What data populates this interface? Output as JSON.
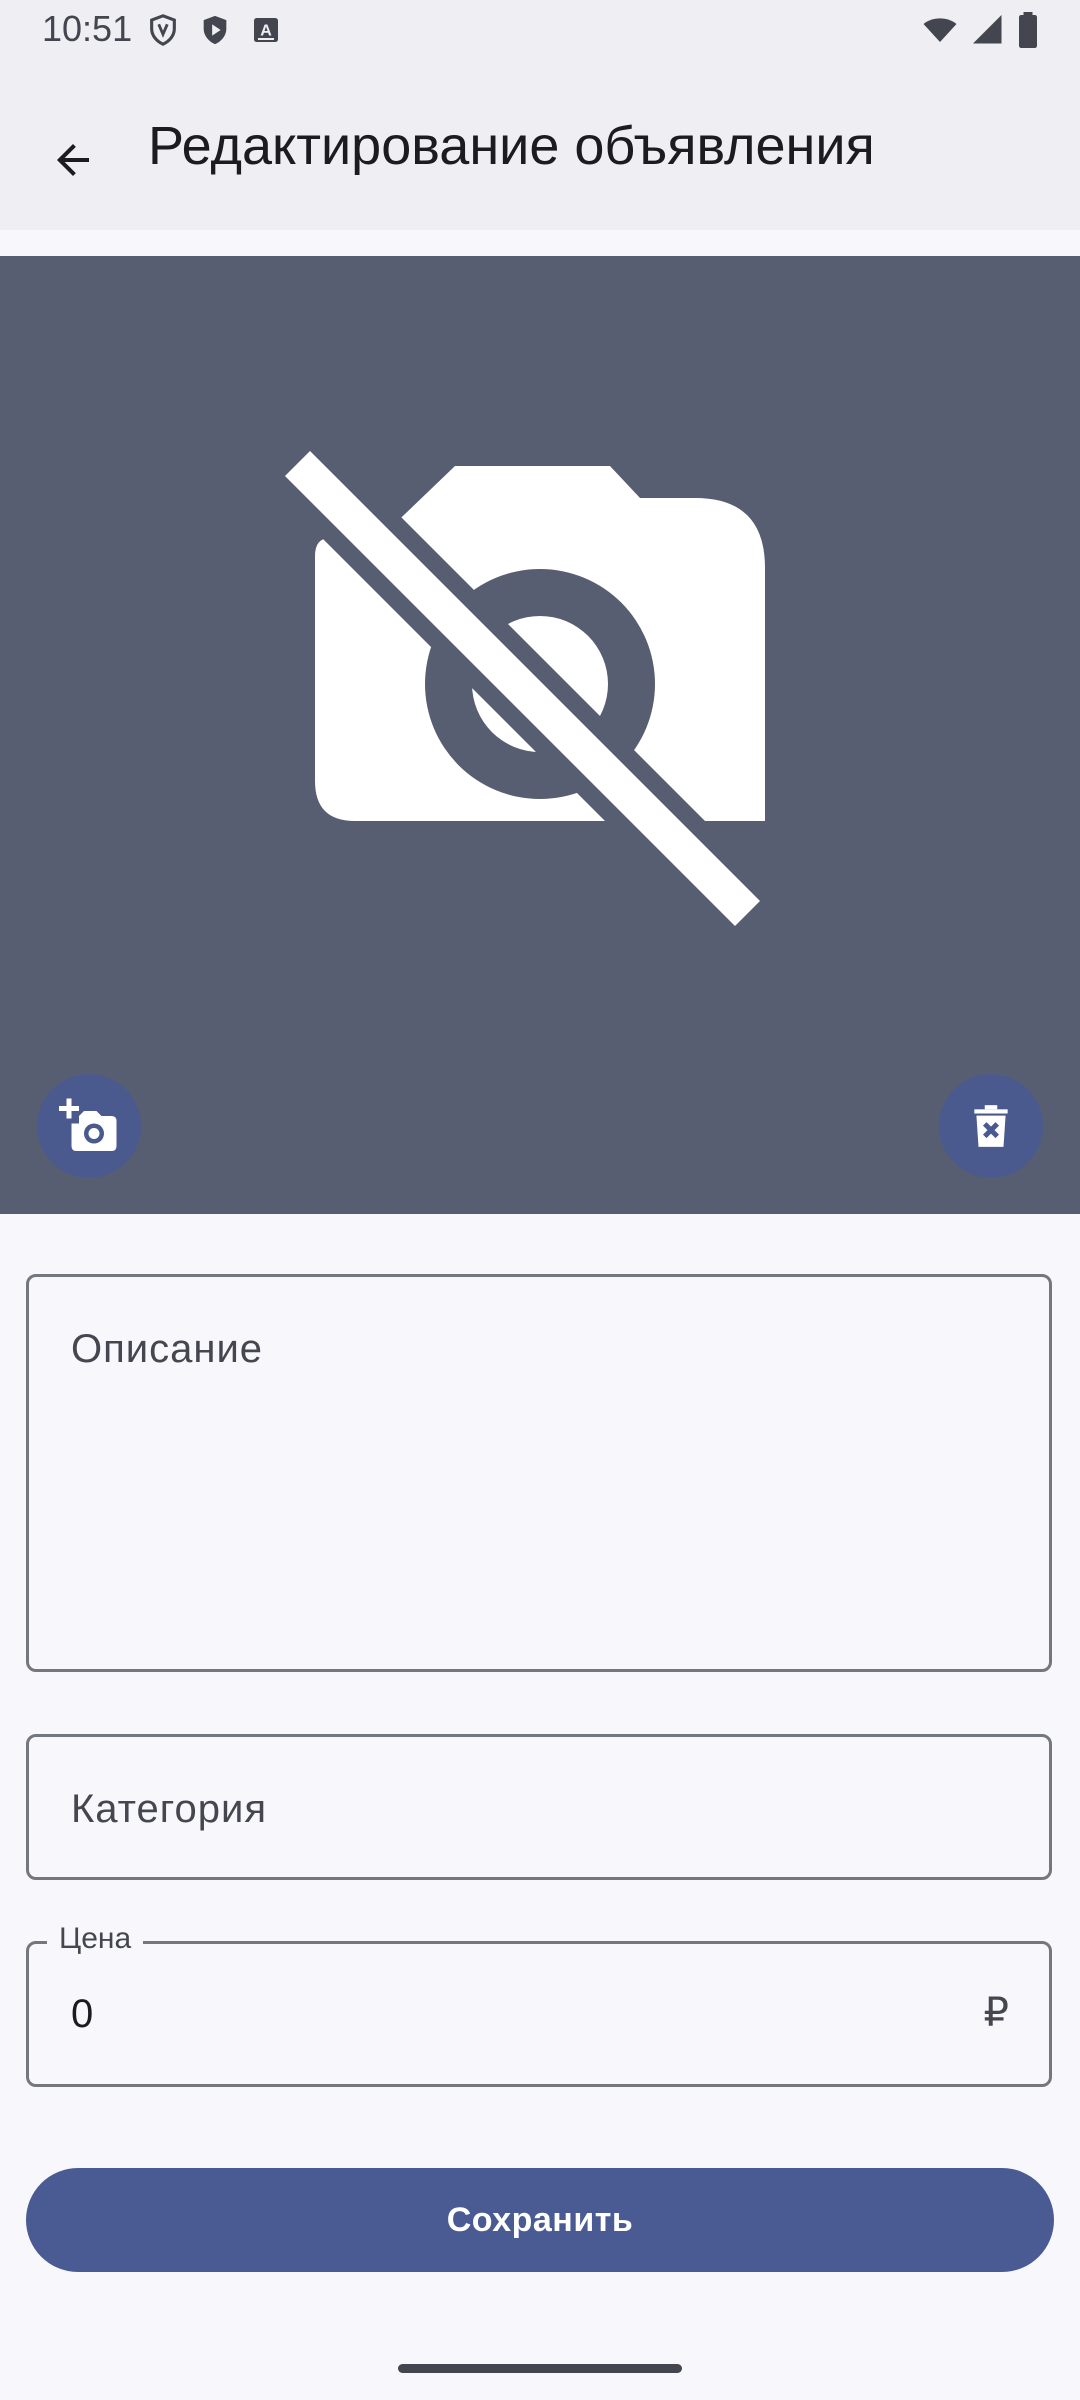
{
  "status_bar": {
    "time": "10:51",
    "left_icons": [
      "vpn-shield-icon",
      "play-protect-icon",
      "keyboard-a-icon"
    ],
    "right_icons": [
      "wifi-icon",
      "signal-icon",
      "battery-icon"
    ]
  },
  "app_bar": {
    "back_icon": "arrow-back-icon",
    "title": "Редактирование объявления"
  },
  "photo": {
    "placeholder_icon": "no-photography-icon",
    "add_icon": "add-a-photo-icon",
    "delete_icon": "delete-forever-icon"
  },
  "form": {
    "description": {
      "label": "Описание",
      "value": ""
    },
    "category": {
      "label": "Категория",
      "value": ""
    },
    "price": {
      "label": "Цена",
      "value": "0",
      "suffix": "₽"
    }
  },
  "actions": {
    "save_label": "Сохранить"
  },
  "colors": {
    "photo_bg": "#585E71",
    "primary": "#4A5A93",
    "surface": "#F7F7FC",
    "app_bar": "#EEEEF3"
  }
}
